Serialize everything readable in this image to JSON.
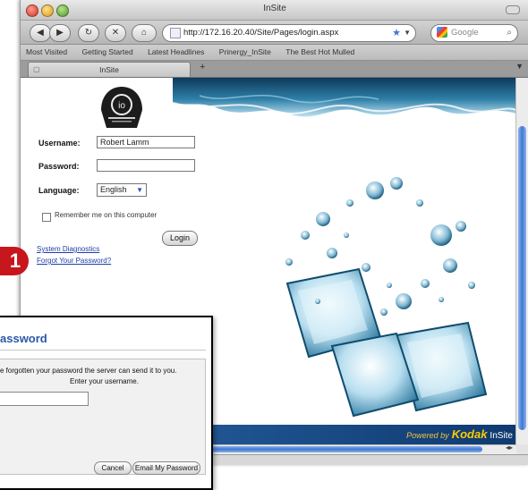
{
  "window": {
    "title": "InSite"
  },
  "toolbar": {
    "url": "http://172.16.20.40/Site/Pages/login.aspx",
    "search_placeholder": "Google"
  },
  "bookmarks": [
    "Most Visited",
    "Getting Started",
    "Latest Headlines",
    "Prinergy_InSite",
    "The Best Hot Mulled"
  ],
  "tabs": [
    {
      "label": "InSite"
    }
  ],
  "login": {
    "username_label": "Username:",
    "username_value": "Robert Lamm",
    "password_label": "Password:",
    "language_label": "Language:",
    "language_value": "English",
    "remember_label": "Remember me on this computer",
    "login_button": "Login",
    "diagnostics_link": "System Diagnostics",
    "forgot_link": "Forgot Your Password?"
  },
  "footer": {
    "powered_by": "Powered by",
    "kodak": "Kodak",
    "insite": "InSite"
  },
  "dialog": {
    "title": "assword",
    "message_line1": "e forgotten your password the server can send it to you.",
    "message_line2": "Enter your username.",
    "cancel_button": "Cancel",
    "email_button": "Email My Password"
  },
  "callout": {
    "number": "1",
    "color": "#c8161d"
  },
  "colors": {
    "accent": "#2a58a8",
    "link": "#1e3fa8",
    "kodak_yellow": "#ffcc00"
  }
}
